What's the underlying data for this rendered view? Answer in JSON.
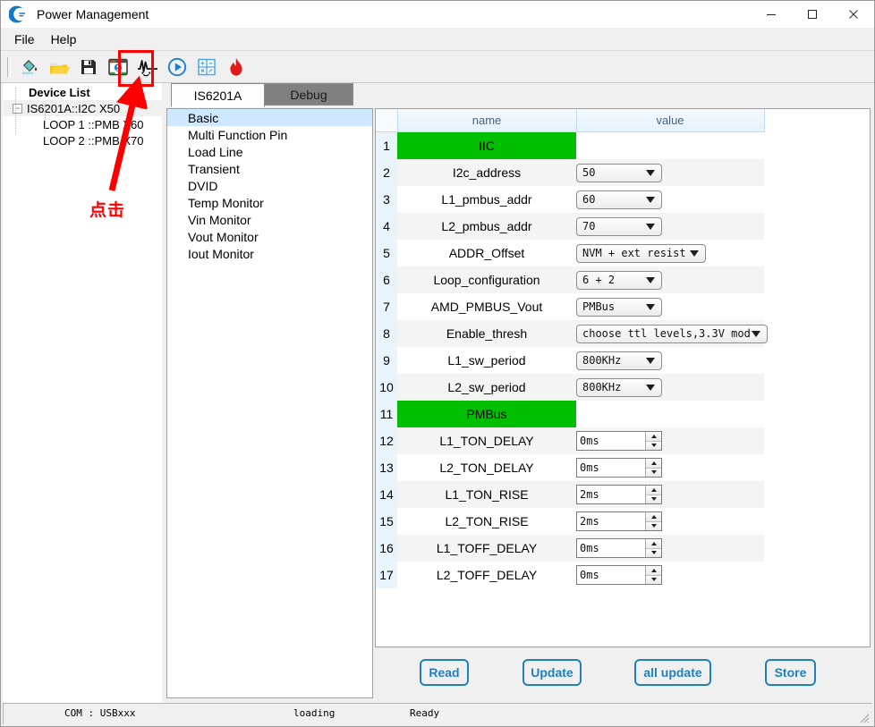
{
  "window": {
    "title": "Power Management",
    "app_icon": "power-crescent-icon",
    "minimize_label": "—",
    "maximize_label": "□",
    "close_label": "✕"
  },
  "menubar": {
    "items": [
      {
        "label": "File",
        "name": "menu-file"
      },
      {
        "label": "Help",
        "name": "menu-help"
      }
    ]
  },
  "toolbar": {
    "buttons": [
      {
        "icon": "paint-bucket-icon",
        "name": "tool-fill"
      },
      {
        "icon": "open-folder-icon",
        "name": "tool-open"
      },
      {
        "icon": "save-disk-icon",
        "name": "tool-save"
      },
      {
        "icon": "monitor-user-icon",
        "name": "tool-device"
      },
      {
        "icon": "waveform-icon",
        "name": "tool-waveform",
        "highlighted": true
      },
      {
        "icon": "play-circle-icon",
        "name": "tool-run"
      },
      {
        "icon": "calculator-icon",
        "name": "tool-calculator"
      },
      {
        "icon": "flame-icon",
        "name": "tool-burn"
      }
    ]
  },
  "tree": {
    "title": "Device List",
    "root": "IS6201A::I2C X50",
    "children": [
      "LOOP 1 ::PMB X60",
      "LOOP 2 ::PMB X70"
    ]
  },
  "tabs": [
    {
      "label": "IS6201A",
      "active": true
    },
    {
      "label": "Debug",
      "active": false
    }
  ],
  "nav": {
    "items": [
      {
        "label": "Basic",
        "selected": true
      },
      {
        "label": "Multi Function Pin",
        "selected": false
      },
      {
        "label": "Load Line",
        "selected": false
      },
      {
        "label": "Transient",
        "selected": false
      },
      {
        "label": "DVID",
        "selected": false
      },
      {
        "label": "Temp Monitor",
        "selected": false
      },
      {
        "label": "Vin Monitor",
        "selected": false
      },
      {
        "label": "Vout Monitor",
        "selected": false
      },
      {
        "label": "Iout Monitor",
        "selected": false
      }
    ]
  },
  "table": {
    "headers": {
      "index": "",
      "name": "name",
      "value": "value"
    },
    "rows": [
      {
        "index": "1",
        "name": "IIC",
        "kind": "section"
      },
      {
        "index": "2",
        "name": "I2c_address",
        "kind": "combo",
        "value": "50",
        "width": "w96"
      },
      {
        "index": "3",
        "name": "L1_pmbus_addr",
        "kind": "combo",
        "value": "60",
        "width": "w96"
      },
      {
        "index": "4",
        "name": "L2_pmbus_addr",
        "kind": "combo",
        "value": "70",
        "width": "w96"
      },
      {
        "index": "5",
        "name": "ADDR_Offset",
        "kind": "combo",
        "value": "NVM + ext resist",
        "width": "w145"
      },
      {
        "index": "6",
        "name": "Loop_configuration",
        "kind": "combo",
        "value": "6 + 2",
        "width": "w96"
      },
      {
        "index": "7",
        "name": "AMD_PMBUS_Vout",
        "kind": "combo",
        "value": "PMBus",
        "width": "w96"
      },
      {
        "index": "8",
        "name": "Enable_thresh",
        "kind": "combo",
        "value": "choose ttl levels,3.3V mod",
        "width": "w214"
      },
      {
        "index": "9",
        "name": "L1_sw_period",
        "kind": "combo",
        "value": "800KHz",
        "width": "w96"
      },
      {
        "index": "10",
        "name": "L2_sw_period",
        "kind": "combo",
        "value": "800KHz",
        "width": "w96"
      },
      {
        "index": "11",
        "name": "PMBus",
        "kind": "section"
      },
      {
        "index": "12",
        "name": "L1_TON_DELAY",
        "kind": "spin",
        "value": "0ms"
      },
      {
        "index": "13",
        "name": "L2_TON_DELAY",
        "kind": "spin",
        "value": "0ms"
      },
      {
        "index": "14",
        "name": "L1_TON_RISE",
        "kind": "spin",
        "value": "2ms"
      },
      {
        "index": "15",
        "name": "L2_TON_RISE",
        "kind": "spin",
        "value": "2ms"
      },
      {
        "index": "16",
        "name": "L1_TOFF_DELAY",
        "kind": "spin",
        "value": "0ms"
      },
      {
        "index": "17",
        "name": "L2_TOFF_DELAY",
        "kind": "spin",
        "value": "0ms"
      }
    ]
  },
  "actions": [
    {
      "label": "Read"
    },
    {
      "label": "Update"
    },
    {
      "label": "all update"
    },
    {
      "label": "Store"
    }
  ],
  "statusbar": {
    "com": "COM : USBxxx",
    "loading": "loading",
    "ready": "Ready"
  },
  "annotation": {
    "text": "点击",
    "color": "#fb0000"
  },
  "colors": {
    "section_green": "#00bf00",
    "accent_blue": "#1f7fbf",
    "selection_blue": "#cde8ff",
    "annotation_red": "#fb0000",
    "active_tab_bg": "#fdfdfd",
    "inactive_tab_bg": "#808080"
  }
}
